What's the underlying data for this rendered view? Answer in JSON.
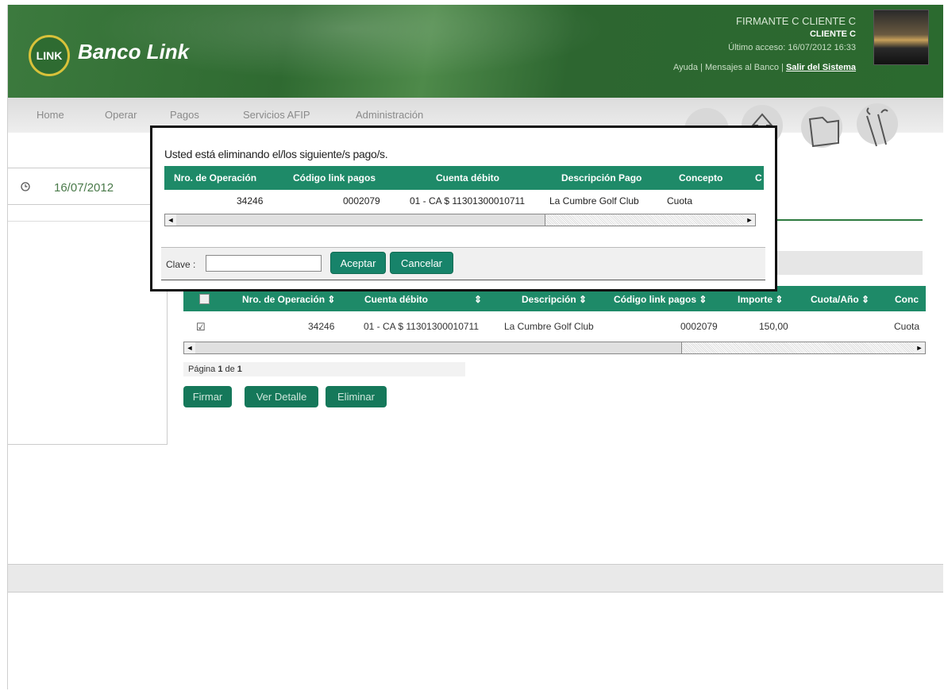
{
  "header": {
    "logo_text": "LINK",
    "brand": "Banco Link",
    "user_name": "FIRMANTE C CLIENTE C",
    "client": "CLIENTE C",
    "last_access": "Último acceso: 16/07/2012 16:33",
    "help": "Ayuda",
    "sep1": "|",
    "messages": "Mensajes al Banco",
    "sep2": "|",
    "logout": "Salir del Sistema"
  },
  "nav": {
    "items": [
      "Home",
      "Operar",
      "Pagos",
      "Servicios AFIP",
      "Administración"
    ]
  },
  "side": {
    "clock_icon": "clock-icon",
    "date": "16/07/2012"
  },
  "table": {
    "headers": [
      "Nro. de Operación ⇕",
      "Cuenta débito",
      "⇕",
      "Descripción ⇕",
      "Código link pagos ⇕",
      "Importe ⇕",
      "Cuota/Año ⇕",
      "Conc"
    ],
    "row": {
      "checkbox": "☑",
      "nro": "34246",
      "cuenta": "01 - CA $ 11301300010711",
      "descripcion": "La Cumbre Golf Club",
      "codigo": "0002079",
      "importe": "150,00",
      "concepto": "Cuota"
    },
    "pager_prefix": "Página ",
    "pager_page": "1",
    "pager_mid": " de ",
    "pager_total": "1"
  },
  "buttons": {
    "firmar": "Firmar",
    "ver_detalle": "Ver Detalle",
    "eliminar": "Eliminar"
  },
  "modal": {
    "title": "Usted está eliminando el/los siguiente/s pago/s.",
    "headers": [
      "Nro. de Operación",
      "Código link pagos",
      "Cuenta débito",
      "Descripción Pago",
      "Concepto",
      "C"
    ],
    "row": {
      "nro": "34246",
      "codigo": "0002079",
      "cuenta": "01 - CA $ 11301300010711",
      "descripcion": "La Cumbre Golf Club",
      "concepto": "Cuota"
    },
    "clave_label": "Clave :",
    "clave_value": "",
    "aceptar": "Aceptar",
    "cancelar": "Cancelar"
  },
  "scroll": {
    "left_arrow": "◄",
    "right_arrow": "►"
  }
}
